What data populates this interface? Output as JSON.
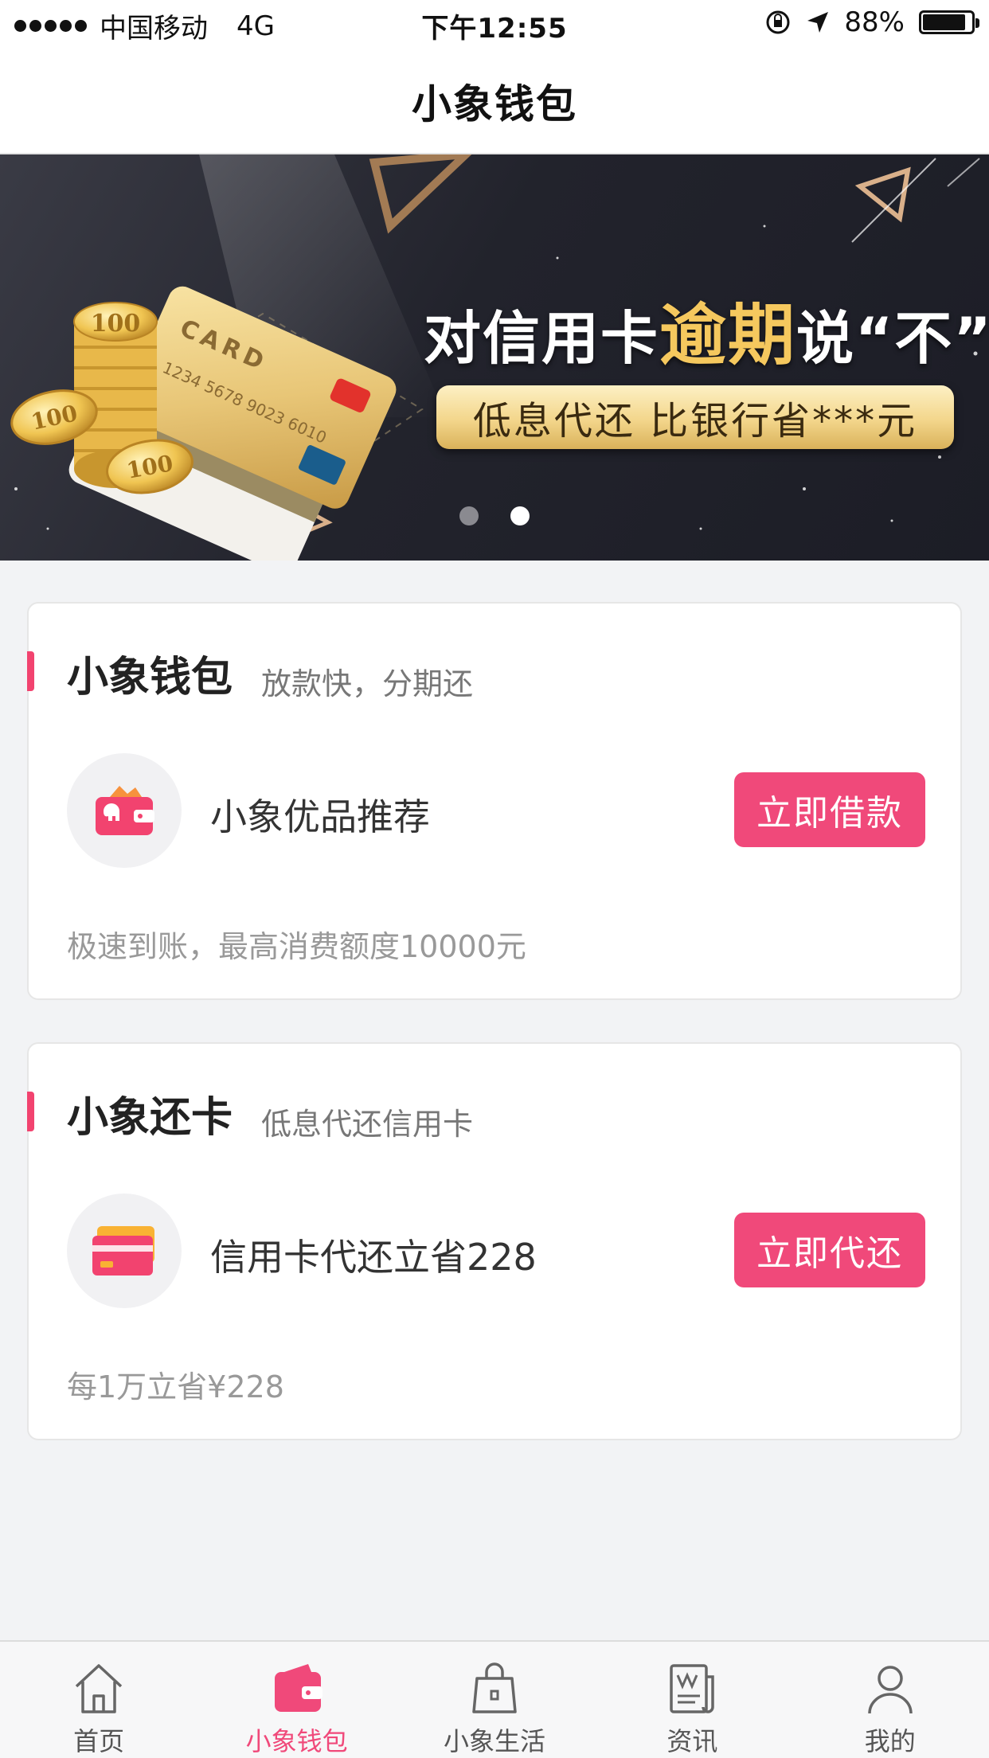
{
  "status_bar": {
    "carrier": "中国移动",
    "network": "4G",
    "time": "下午12:55",
    "battery": "88%",
    "battery_level": 0.88
  },
  "nav": {
    "title": "小象钱包"
  },
  "banner": {
    "headline_pre": "对信用卡",
    "headline_highlight": "逾期",
    "headline_post": "说“不”",
    "pill": "低息代还 比银行省***元",
    "card_text": "CARD",
    "card_number": "1234 5678 9023 6010",
    "coin_label": "100",
    "page_count": 2,
    "active_page": 2,
    "colors": {
      "gold": "#f5c85e",
      "dark": "#22232c"
    }
  },
  "cards": [
    {
      "title": "小象钱包",
      "subtitle": "放款快，分期还",
      "item_icon": "elephant-wallet-icon",
      "item_label": "小象优品推荐",
      "cta_label": "立即借款",
      "footer": "极速到账，最高消费额度10000元"
    },
    {
      "title": "小象还卡",
      "subtitle": "低息代还信用卡",
      "item_icon": "credit-card-icon",
      "item_label": "信用卡代还立省228",
      "cta_label": "立即代还",
      "footer": "每1万立省¥228"
    }
  ],
  "tabs": [
    {
      "label": "首页",
      "icon": "home-icon",
      "active": false
    },
    {
      "label": "小象钱包",
      "icon": "wallet-icon",
      "active": true
    },
    {
      "label": "小象生活",
      "icon": "shopping-bag-icon",
      "active": false
    },
    {
      "label": "资讯",
      "icon": "news-icon",
      "active": false
    },
    {
      "label": "我的",
      "icon": "user-icon",
      "active": false
    }
  ],
  "colors": {
    "accent": "#f0497a",
    "bar": "#f2436f"
  }
}
